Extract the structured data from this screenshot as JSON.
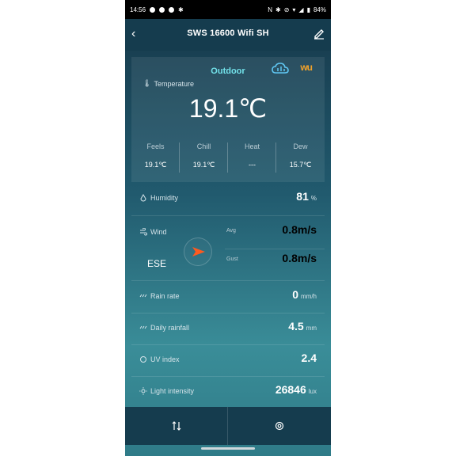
{
  "statusbar": {
    "time": "14:56",
    "battery": "84%"
  },
  "header": {
    "title": "SWS 16600 Wifi SH"
  },
  "outdoor": {
    "title": "Outdoor",
    "temperature_label": "Temperature",
    "temperature_value": "19.1℃",
    "sub": [
      {
        "label": "Feels",
        "value": "19.1℃"
      },
      {
        "label": "Chill",
        "value": "19.1℃"
      },
      {
        "label": "Heat",
        "value": "---"
      },
      {
        "label": "Dew",
        "value": "15.7℃"
      }
    ]
  },
  "humidity": {
    "label": "Humidity",
    "value": "81",
    "unit": "%"
  },
  "wind": {
    "label": "Wind",
    "direction": "ESE",
    "avg_label": "Avg",
    "gust_label": "Gust",
    "avg_value": "0.8",
    "gust_value": "0.8",
    "unit": "m/s",
    "accent": "#ff5a1f"
  },
  "rain_rate": {
    "label": "Rain rate",
    "value": "0",
    "unit": "mm/h"
  },
  "daily_rainfall": {
    "label": "Daily rainfall",
    "value": "4.5",
    "unit": "mm"
  },
  "uv": {
    "label": "UV index",
    "value": "2.4"
  },
  "light": {
    "label": "Light intensity",
    "value": "26846",
    "unit": "lux"
  },
  "colors": {
    "accent": "#72e1e9",
    "header_bg": "#153c4e",
    "wu_brand": "#f0a12a"
  },
  "wu_logo": "wu"
}
